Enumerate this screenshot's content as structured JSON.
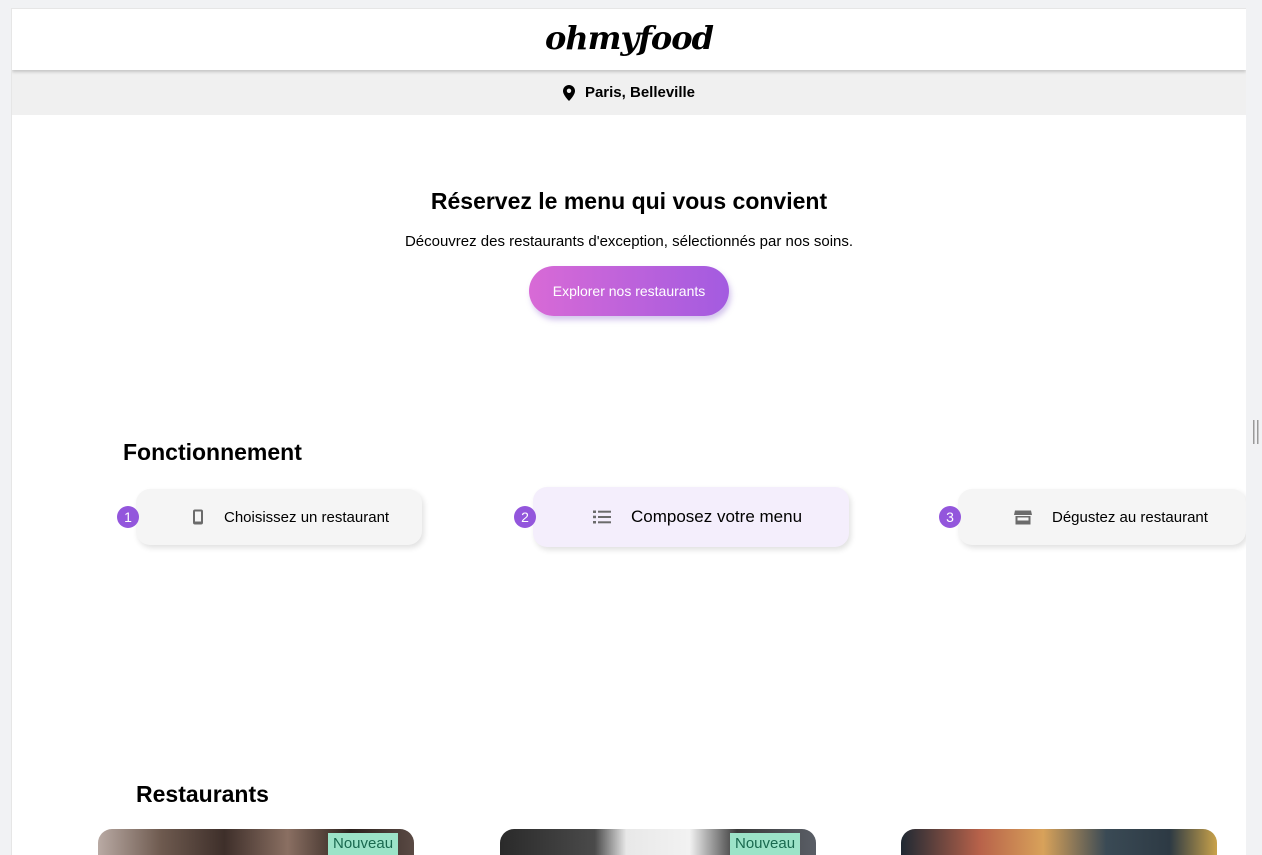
{
  "brand": {
    "logo": "ohmyfood"
  },
  "location": {
    "icon": "map-pin-icon",
    "text": "Paris, Belleville"
  },
  "hero": {
    "title": "Réservez le menu qui vous convient",
    "subtitle": "Découvrez des restaurants d'exception, sélectionnés par nos soins.",
    "cta_label": "Explorer nos restaurants"
  },
  "how": {
    "title": "Fonctionnement",
    "steps": [
      {
        "number": "1",
        "icon": "mobile-phone-icon",
        "label": "Choisissez un restaurant"
      },
      {
        "number": "2",
        "icon": "list-icon",
        "label": "Composez votre menu"
      },
      {
        "number": "3",
        "icon": "store-icon",
        "label": "Dégustez au restaurant"
      }
    ]
  },
  "restaurants": {
    "title": "Restaurants",
    "badges": [
      "Nouveau",
      "Nouveau"
    ]
  },
  "colors": {
    "accent": "#9356dc",
    "badge_bg": "#9ce3c8",
    "active_step_bg": "#f4eefc"
  }
}
